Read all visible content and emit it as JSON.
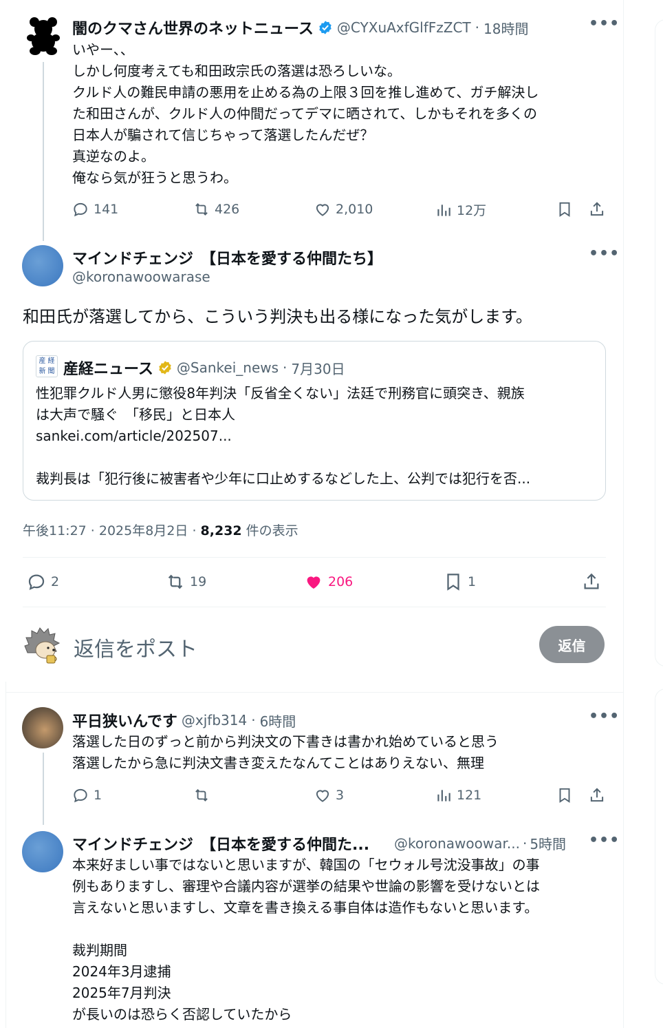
{
  "tweet1": {
    "author_name": "闇のクマさん世界のネットニュース",
    "handle": "@CYXuAxfGlfFzZCT",
    "time": "18時間",
    "text": "いやー、、\nしかし何度考えても和田政宗氏の落選は恐ろしいな。\nクルド人の難民申請の悪用を止める為の上限３回を推し進めて、ガチ解決し\nた和田さんが、クルド人の仲間だってデマに晒されて、しかもそれを多くの\n日本人が騙されて信じちゃって落選したんだぜ？\n真逆なのよ。\n俺なら気が狂うと思うわ。",
    "replies": "141",
    "reposts": "426",
    "likes": "2,010",
    "views": "12万"
  },
  "main": {
    "author_name": "マインドチェンジ　【日本を愛する仲間たち】",
    "handle": "@koronawoowarase",
    "text": "和田氏が落選してから、こういう判決も出る様になった気がします。",
    "quote": {
      "author_name": "産経ニュース",
      "handle": "@Sankei_news",
      "time": "7月30日",
      "text": "性犯罪クルド人男に懲役8年判決「反省全くない」法廷で刑務官に頭突き、親族\nは大声で騒ぐ　「移民」と日本人\nsankei.com/article/202507...\n\n裁判長は「犯行後に被害者や少年に口止めするなどした上、公判では犯行を否..."
    },
    "timestamp": "午後11:27 · 2025年8月2日 · ",
    "views_count": "8,232",
    "views_label": " 件の表示",
    "replies": "2",
    "reposts": "19",
    "likes": "206",
    "bookmarks": "1",
    "like_color": "#f91880"
  },
  "composer": {
    "placeholder": "返信をポスト",
    "button_label": "返信"
  },
  "reply1": {
    "author_name": "平日狭いんです",
    "handle": "@xjfb314",
    "time": "6時間",
    "text": "落選した日のずっと前から判決文の下書きは書かれ始めていると思う\n落選したから急に判決文書き変えたなんてことはありえない、無理",
    "replies": "1",
    "reposts": "",
    "likes": "3",
    "views": "121"
  },
  "reply2": {
    "author_name": "マインドチェンジ　【日本を愛する仲間た...",
    "handle": "@koronawoowar...",
    "time": "5時間",
    "text": "本来好ましい事ではないと思いますが、韓国の「セウォル号沈没事故」の事\n例もありますし、審理や合議内容が選挙の結果や世論の影響を受けないとは\n言えないと思いますし、文章を書き換える事自体は造作もないと思います。\n\n裁判期間\n2024年3月逮捕\n2025年7月判決\nが長いのは恐らく否認していたから"
  },
  "colors": {
    "text": "#0f1419",
    "secondary": "#536471",
    "verified_blue": "#1d9bf0",
    "verified_gold": "#e2b719",
    "like_pink": "#f91880"
  },
  "separators": {
    "dot": " · "
  }
}
